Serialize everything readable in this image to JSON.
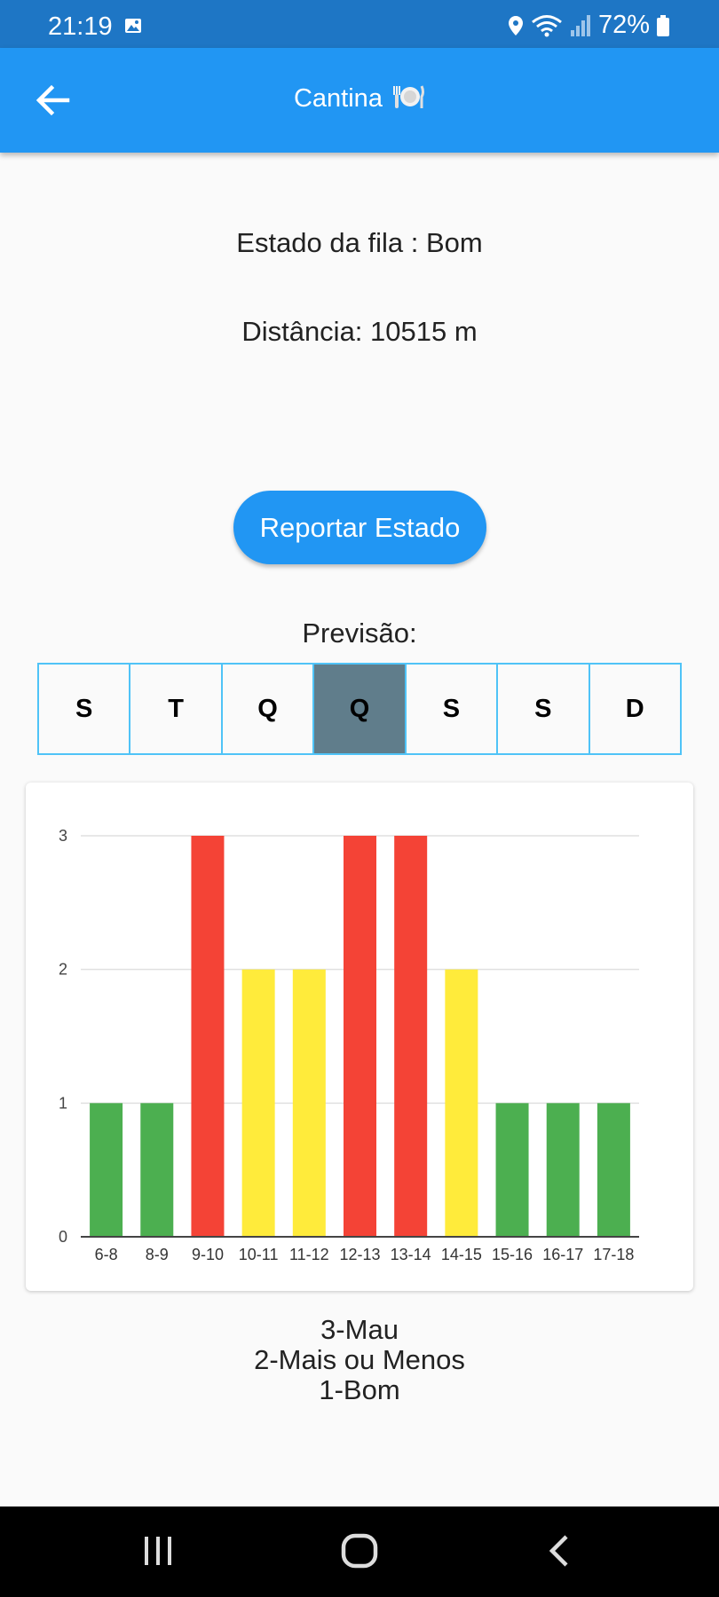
{
  "status_bar": {
    "time": "21:19",
    "battery": "72%"
  },
  "app_bar": {
    "title": "Cantina",
    "plate_icon": "plate-with-cutlery-icon",
    "back_icon": "arrow-left-icon",
    "color": "#2196f3"
  },
  "queue": {
    "status_text": "Estado da fila : Bom",
    "distance_text": "Distância: 10515 m"
  },
  "report_button": {
    "label": "Reportar Estado"
  },
  "forecast": {
    "label": "Previsão:",
    "days": [
      "S",
      "T",
      "Q",
      "Q",
      "S",
      "S",
      "D"
    ],
    "selected_index": 3
  },
  "chart_data": {
    "type": "bar",
    "categories": [
      "6-8",
      "8-9",
      "9-10",
      "10-11",
      "11-12",
      "12-13",
      "13-14",
      "14-15",
      "15-16",
      "16-17",
      "17-18"
    ],
    "values": [
      1,
      1,
      3,
      2,
      2,
      3,
      3,
      2,
      1,
      1,
      1
    ],
    "ylim": [
      0,
      3
    ],
    "yticks": [
      "0",
      "1",
      "2",
      "3"
    ],
    "grid": true,
    "colors": {
      "1": "#4caf50",
      "2": "#ffeb3b",
      "3": "#f44336"
    }
  },
  "legend": {
    "lines": [
      "3-Mau",
      "2-Mais ou Menos",
      "1-Bom"
    ]
  },
  "nav_bar": {
    "recent_icon": "recent-apps-icon",
    "home_icon": "home-icon",
    "back_icon": "back-chevron-icon"
  }
}
